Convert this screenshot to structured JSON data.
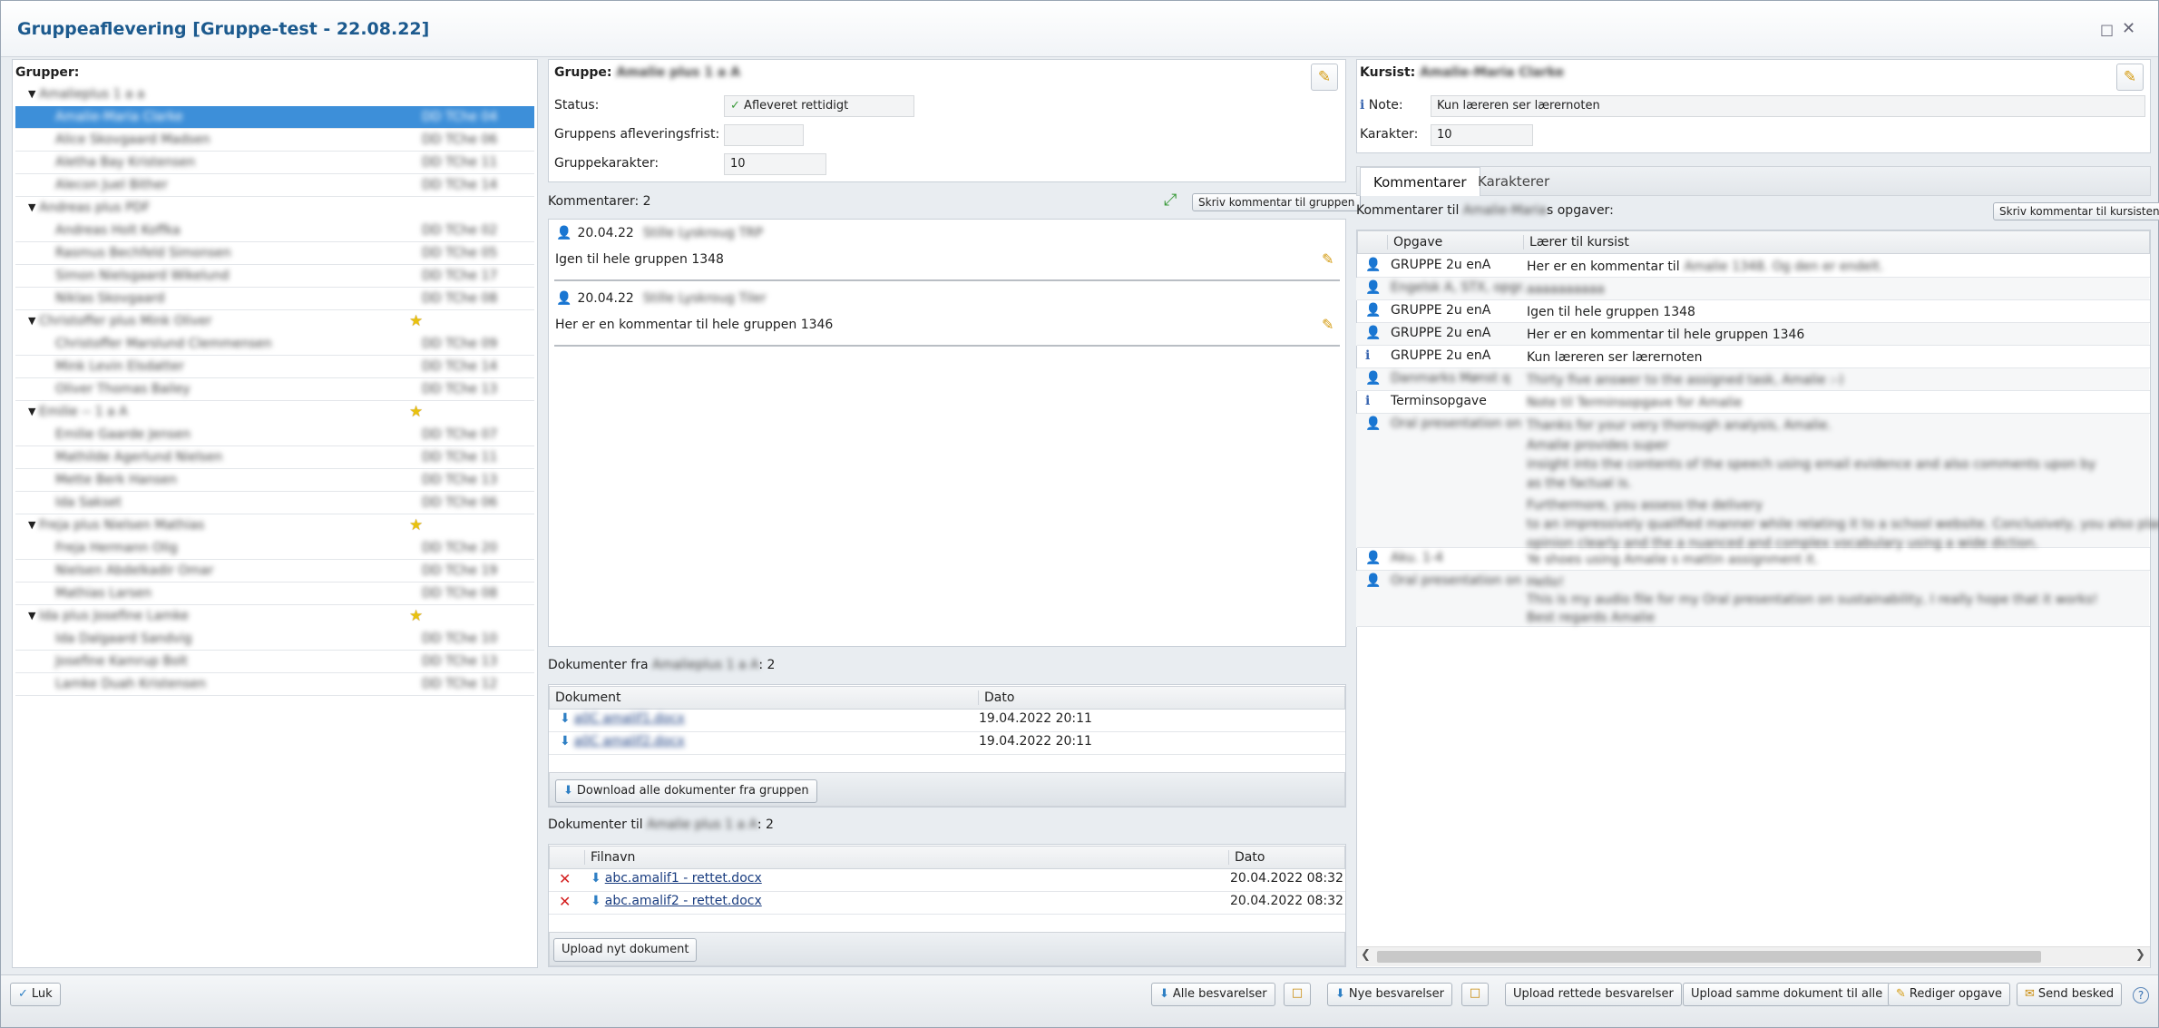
{
  "window": {
    "title": "Gruppeaflevering [Gruppe-test - 22.08.22]"
  },
  "groups_panel": {
    "heading": "Grupper:",
    "groups": [
      {
        "name": "Amalieplus 1 a a",
        "star": false,
        "members": [
          {
            "name": "Amalie-Maria Clarke",
            "date": "DD TChe 04",
            "selected": true
          },
          {
            "name": "Alice Skovgaard Madsen",
            "date": "DD TChe 06"
          },
          {
            "name": "Aletha Bay Kristensen",
            "date": "DD TChe 11"
          },
          {
            "name": "Alecon Juel Bither",
            "date": "DD TChe 14"
          }
        ]
      },
      {
        "name": "Andreas plus PDF",
        "star": false,
        "members": [
          {
            "name": "Andreas Holt Koffka",
            "date": "DD TChe 02"
          },
          {
            "name": "Rasmus Bechfeld Simonsen",
            "date": "DD TChe 05"
          },
          {
            "name": "Simon Nielsgaard Wikelund",
            "date": "DD TChe 17"
          },
          {
            "name": "Niklas Skovgaard",
            "date": "DD TChe 08"
          }
        ]
      },
      {
        "name": "Christoffer plus Mink Oliver",
        "star": true,
        "members": [
          {
            "name": "Christoffer Marslund Clemmensen",
            "date": "DD TChe 09"
          },
          {
            "name": "Mink Levin Elsdatter",
            "date": "DD TChe 14"
          },
          {
            "name": "Oliver Thomas Bailey",
            "date": "DD TChe 13"
          }
        ]
      },
      {
        "name": "Emilie -- 1 a A",
        "star": true,
        "members": [
          {
            "name": "Emilie Gaarde Jensen",
            "date": "DD TChe 07"
          },
          {
            "name": "Mathilde Agerlund Nielsen",
            "date": "DD TChe 11"
          },
          {
            "name": "Mette Berk Hansen",
            "date": "DD TChe 13"
          },
          {
            "name": "Ida Sakset",
            "date": "DD TChe 06"
          }
        ]
      },
      {
        "name": "Freja plus Nielsen Mathias",
        "star": true,
        "members": [
          {
            "name": "Freja Hermann Olig",
            "date": "DD TChe 20"
          },
          {
            "name": "Nielsen Abdelkadir Omar",
            "date": "DD TChe 19"
          },
          {
            "name": "Mathias Larsen",
            "date": "DD TChe 08"
          }
        ]
      },
      {
        "name": "Ida plus Josefine Lamke",
        "star": true,
        "members": [
          {
            "name": "Ida Dalgaard Sandvig",
            "date": "DD TChe 10"
          },
          {
            "name": "Josefine Kamrup Bolt",
            "date": "DD TChe 13"
          },
          {
            "name": "Lamke Duah Kristensen",
            "date": "DD TChe 12"
          }
        ]
      }
    ]
  },
  "group_panel": {
    "group_label": "Gruppe:",
    "group_name": "Amalie plus 1 a A",
    "status_label": "Status:",
    "status_value": "Afleveret rettidigt",
    "deadline_label": "Gruppens afleveringsfrist:",
    "deadline_value": "",
    "grade_label": "Gruppekarakter:",
    "grade_value": "10",
    "comments_label": "Kommentarer:",
    "comments_count": "2",
    "write_comment_button": "Skriv kommentar til gruppen",
    "comments": [
      {
        "date": "20.04.22",
        "author": "Stille Lyskroug TRP",
        "text": "Igen til hele gruppen 1348"
      },
      {
        "date": "20.04.22",
        "author": "Stille Lyskroug Tiler",
        "text": "Her er en kommentar til hele gruppen 1346"
      }
    ],
    "docs_from_label": "Dokumenter fra",
    "docs_from_group": "Amalieplus 1 a A",
    "docs_from_count": ": 2",
    "docs_from_headers": [
      "Dokument",
      "Dato"
    ],
    "docs_from": [
      {
        "name": "a0C amalif1.docx",
        "date": "19.04.2022 20:11"
      },
      {
        "name": "a0C amalif2.docx",
        "date": "19.04.2022 20:11"
      }
    ],
    "download_all_button": "Download alle dokumenter fra gruppen",
    "docs_to_label": "Dokumenter til",
    "docs_to_group": "Amalie plus 1 a A",
    "docs_to_count": ": 2",
    "docs_to_headers": [
      "Filnavn",
      "Dato"
    ],
    "docs_to": [
      {
        "name": "abc.amalif1 - rettet.docx",
        "date": "20.04.2022 08:32"
      },
      {
        "name": "abc.amalif2 - rettet.docx",
        "date": "20.04.2022 08:32"
      }
    ],
    "upload_new_button": "Upload nyt dokument"
  },
  "student_panel": {
    "student_label": "Kursist:",
    "student_name": "Amalie-Maria Clarke",
    "note_label": "Note:",
    "note_value": "Kun læreren ser lærernoten",
    "grade_label": "Karakter:",
    "grade_value": "10",
    "tabs": [
      "Kommentarer",
      "Karakterer"
    ],
    "comments_to_label": "Kommentarer til",
    "comments_to_name": "Amalie-Maria",
    "comments_to_suffix": "s opgaver:",
    "write_comment_button": "Skriv kommentar til kursisten",
    "table_headers": [
      "Opgave",
      "Lærer til kursist"
    ],
    "rows": [
      {
        "icon": "person-icon",
        "task": "GRUPPE 2u enA",
        "text_a": "Her er en kommentar til",
        "text_b": "Amalie 1348. Og den er endelt.",
        "text_c": ""
      },
      {
        "icon": "person-icon",
        "task": "Engelsk A, STX, opgr.",
        "text_a": "",
        "text_b": "aaaaaaaaaa",
        "text_c": ""
      },
      {
        "icon": "person-icon",
        "task": "GRUPPE 2u enA",
        "text_a": "Igen til hele gruppen 1348",
        "text_b": "",
        "text_c": ""
      },
      {
        "icon": "person-icon",
        "task": "GRUPPE 2u enA",
        "text_a": "Her er en kommentar til hele gruppen 1346",
        "text_b": "",
        "text_c": ""
      },
      {
        "icon": "info-icon",
        "task": "GRUPPE 2u enA",
        "text_a": "Kun læreren ser lærernoten",
        "text_b": "",
        "text_c": ""
      },
      {
        "icon": "person-icon",
        "task": "Danmarks Mønst q",
        "text_a": "",
        "text_b": "Thirty five answer to the assigned task, Amalie :-)",
        "text_c": ""
      },
      {
        "icon": "info-icon",
        "task": "Terminsopgave",
        "text_a": "",
        "text_b": "Note til Terminsopgave for Amalie",
        "text_c": ""
      },
      {
        "icon": "person-icon",
        "task": "Oral presentation on",
        "text_a": "",
        "text_b": "Thanks for your very thorough analysis, Amalie.",
        "text_c": ""
      },
      {
        "icon": "green-icon",
        "task": "Aku. 1-4",
        "text_a": "",
        "text_b": "Ye shoes using Amalie s mattin assignment it.",
        "text_c": ""
      },
      {
        "icon": "green-icon",
        "task": "Oral presentation on",
        "text_a": "",
        "text_b": "Hello!",
        "text_c": ""
      }
    ],
    "oral_extra_lines": [
      "Amalie provides super",
      "insight into the contents of the speech using email evidence and also comments upon by",
      "as the factual is.",
      "Furthermore, you assess the delivery",
      "to an impressively qualified manner while relating it to a school website. Conclusively, you also place it and",
      "opinion clearly and the a nuanced and complex vocabulary using a wide diction."
    ],
    "hello_extra_lines": [
      "This is my audio file for my Oral presentation on sustainability, I really hope that it works!",
      "Best regards Amalie"
    ]
  },
  "bottom_bar": {
    "close_button": "Luk",
    "all_answers_button": "Alle besvarelser",
    "new_answers_button": "Nye besvarelser",
    "upload_corrected_button": "Upload rettede besvarelser",
    "upload_same_button": "Upload samme dokument til alle",
    "edit_task_button": "Rediger opgave",
    "send_message_button": "Send besked",
    "help": "?"
  }
}
